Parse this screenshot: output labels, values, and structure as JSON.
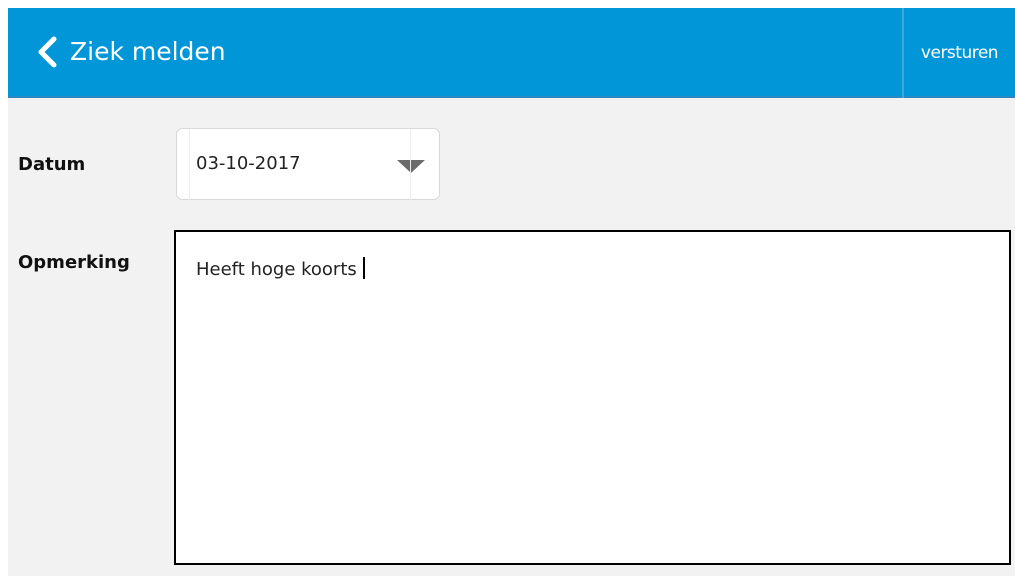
{
  "header": {
    "title": "Ziek melden",
    "back_icon": "chevron-left-icon",
    "send_label": "versturen",
    "background_color": "#0096d8",
    "text_color": "#ffffff"
  },
  "form": {
    "date": {
      "label": "Datum",
      "value": "03-10-2017",
      "dropdown_icon": "caret-down-icon"
    },
    "remark": {
      "label": "Opmerking",
      "value": "Heeft hoge koorts"
    }
  }
}
